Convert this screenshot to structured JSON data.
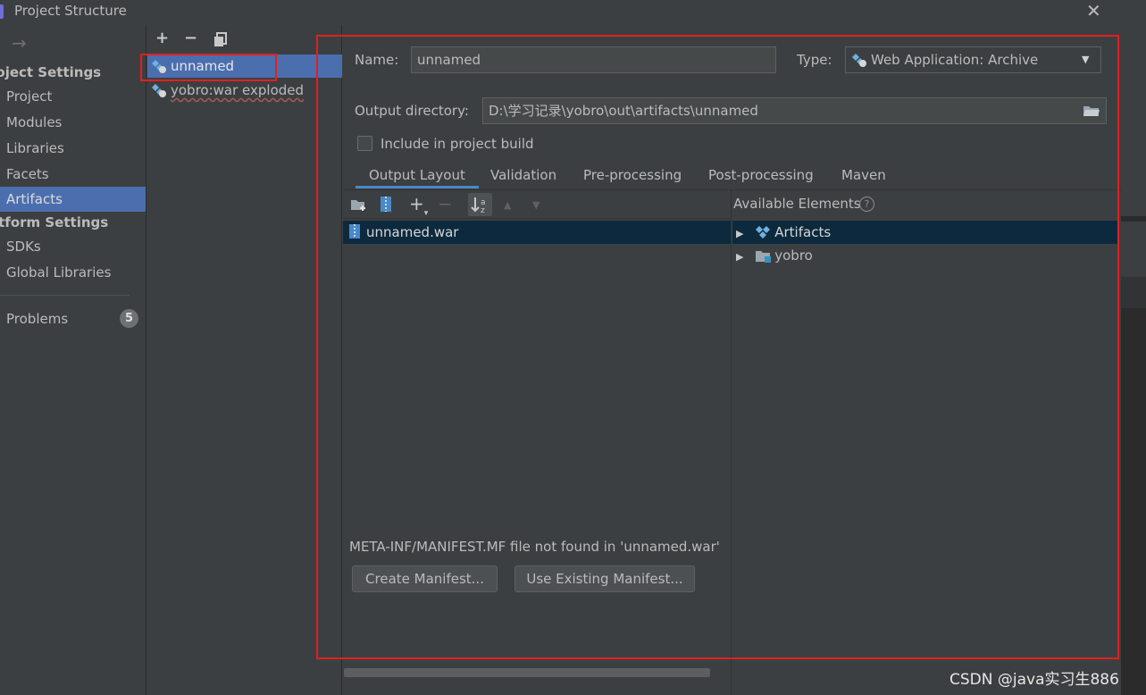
{
  "window": {
    "title": "Project Structure",
    "close_glyph": "✕"
  },
  "nav": {
    "back_glyph": "→",
    "project_settings_header": "roject Settings",
    "project_items": [
      "Project",
      "Modules",
      "Libraries",
      "Facets",
      "Artifacts"
    ],
    "selected": "Artifacts",
    "platform_settings_header": "atform Settings",
    "platform_items": [
      "SDKs",
      "Global Libraries"
    ],
    "problems_label": "Problems",
    "problems_count": "5"
  },
  "artifacts_list": {
    "toolbar": {
      "add": "+",
      "remove": "−",
      "copy": "copy-icon"
    },
    "items": [
      {
        "label": "unnamed",
        "selected": true
      },
      {
        "label": "yobro:war exploded",
        "selected": false
      }
    ]
  },
  "editor": {
    "name_label": "Name:",
    "name_value": "unnamed",
    "type_label": "Type:",
    "type_value": "Web Application: Archive",
    "output_dir_label": "Output directory:",
    "output_dir_value": "D:\\学习记录\\yobro\\out\\artifacts\\unnamed",
    "include_label": "Include in project build",
    "include_checked": false,
    "tabs": [
      "Output Layout",
      "Validation",
      "Pre-processing",
      "Post-processing",
      "Maven"
    ],
    "active_tab": "Output Layout",
    "layout_toolbar": [
      "new-folder-icon",
      "archive-icon",
      "add-icon",
      "remove-icon",
      "sort-icon",
      "move-up-icon",
      "move-down-icon"
    ],
    "layout_tree": [
      {
        "label": "unnamed.war",
        "selected": true
      }
    ],
    "available_title": "Available Elements",
    "available_tree": [
      {
        "label": "Artifacts",
        "selected": true
      },
      {
        "label": "yobro",
        "selected": false
      }
    ],
    "manifest_warning": "META-INF/MANIFEST.MF file not found in 'unnamed.war'",
    "create_manifest_button": "Create Manifest...",
    "use_existing_button": "Use Existing Manifest..."
  },
  "watermark": "CSDN @java实习生886",
  "colors": {
    "selection": "#4b6eaf",
    "tree_selection": "#0d293e",
    "highlight_frame": "#e02020"
  }
}
